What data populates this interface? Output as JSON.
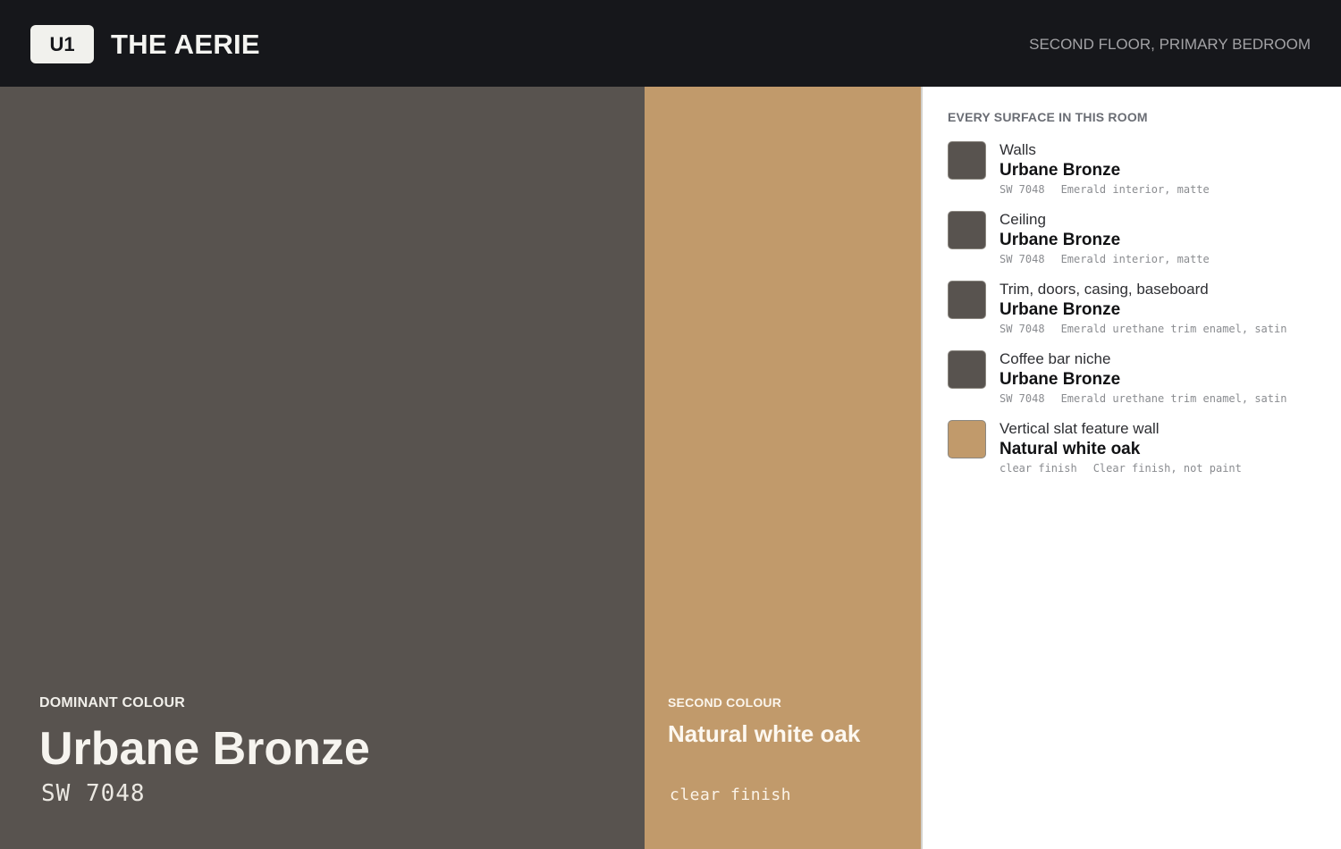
{
  "header": {
    "unit": "U1",
    "home_title": "THE AERIE",
    "room": "SECOND FLOOR, PRIMARY BEDROOM"
  },
  "dominant": {
    "label": "DOMINANT COLOUR",
    "name": "Urbane Bronze",
    "code": "SW 7048",
    "color": "#58534f"
  },
  "second": {
    "label": "SECOND COLOUR",
    "name": "Natural white oak",
    "code": "clear finish",
    "color": "#c19a6b"
  },
  "surfaces": {
    "heading": "EVERY SURFACE IN THIS ROOM",
    "items": [
      {
        "surface": "Walls",
        "colour": "Urbane Bronze",
        "code": "SW 7048",
        "spec": "Emerald interior, matte",
        "swatch": "#58534f"
      },
      {
        "surface": "Ceiling",
        "colour": "Urbane Bronze",
        "code": "SW 7048",
        "spec": "Emerald interior, matte",
        "swatch": "#58534f"
      },
      {
        "surface": "Trim, doors, casing, baseboard",
        "colour": "Urbane Bronze",
        "code": "SW 7048",
        "spec": "Emerald urethane trim enamel, satin",
        "swatch": "#58534f"
      },
      {
        "surface": "Coffee bar niche",
        "colour": "Urbane Bronze",
        "code": "SW 7048",
        "spec": "Emerald urethane trim enamel, satin",
        "swatch": "#58534f"
      },
      {
        "surface": "Vertical slat feature wall",
        "colour": "Natural white oak",
        "code": "clear finish",
        "spec": "Clear finish, not paint",
        "swatch": "#c19a6b"
      }
    ]
  }
}
